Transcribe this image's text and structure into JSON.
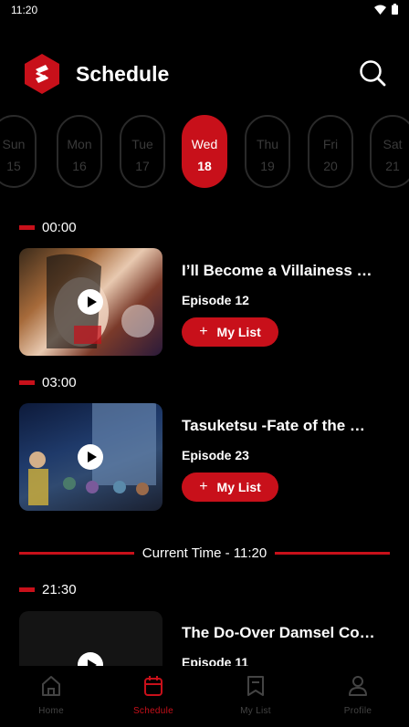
{
  "status_bar": {
    "time": "11:20"
  },
  "header": {
    "title": "Schedule"
  },
  "days": [
    {
      "name": "Sun",
      "num": "15",
      "active": false
    },
    {
      "name": "Mon",
      "num": "16",
      "active": false
    },
    {
      "name": "Tue",
      "num": "17",
      "active": false
    },
    {
      "name": "Wed",
      "num": "18",
      "active": true
    },
    {
      "name": "Thu",
      "num": "19",
      "active": false
    },
    {
      "name": "Fri",
      "num": "20",
      "active": false
    },
    {
      "name": "Sat",
      "num": "21",
      "active": false
    }
  ],
  "schedule": [
    {
      "time": "00:00",
      "title": "I’ll Become a Villainess Who Goes Down in History",
      "episode": "Episode 12",
      "button": "My List"
    },
    {
      "time": "03:00",
      "title": "Tasuketsu -Fate of the Majority-",
      "episode": "Episode 23",
      "button": "My List"
    },
    {
      "time": "21:30",
      "title": "The Do-Over Damsel Conquers the Dragon Emperor",
      "episode": "Episode 11"
    }
  ],
  "current_time_label": "Current Time - 11:20",
  "nav": {
    "items": [
      {
        "label": "Home",
        "icon": "home-icon",
        "active": false
      },
      {
        "label": "Schedule",
        "icon": "calendar-icon",
        "active": true
      },
      {
        "label": "My List",
        "icon": "bookmark-icon",
        "active": false
      },
      {
        "label": "Profile",
        "icon": "user-icon",
        "active": false
      }
    ]
  },
  "colors": {
    "accent": "#c8101a",
    "background": "#000000",
    "inactive": "#444444"
  }
}
